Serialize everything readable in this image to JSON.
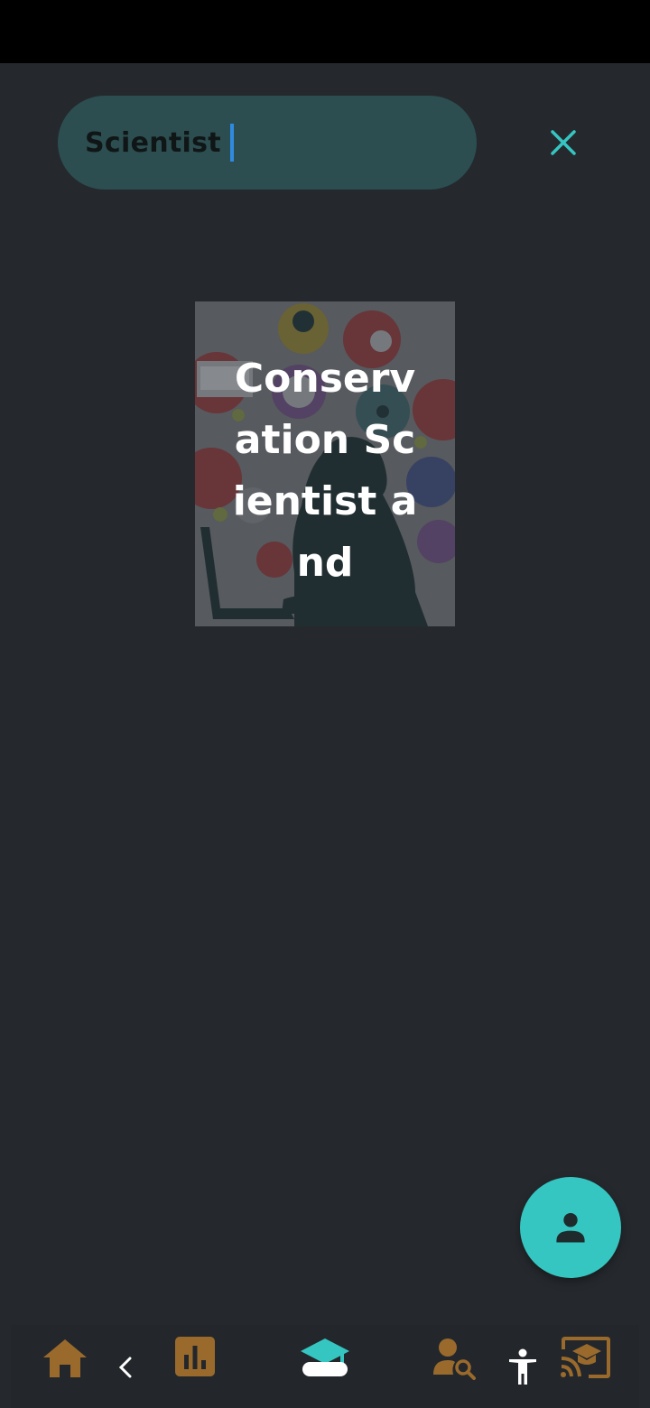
{
  "search": {
    "value": "Scientist"
  },
  "result_card": {
    "title": "Conservation Scientist and"
  },
  "icons": {
    "close": "close-icon",
    "person": "person-icon",
    "home": "home-icon",
    "back": "chevron-left-icon",
    "chart": "bar-chart-icon",
    "school": "graduation-cap-icon",
    "person_search": "person-search-icon",
    "accessibility": "accessibility-icon",
    "cast_education": "cast-education-icon"
  },
  "colors": {
    "background": "#25292d",
    "search_pill": "#2c4e50",
    "accent": "#36c6c2",
    "nav_icon": "#9a6a2c"
  }
}
